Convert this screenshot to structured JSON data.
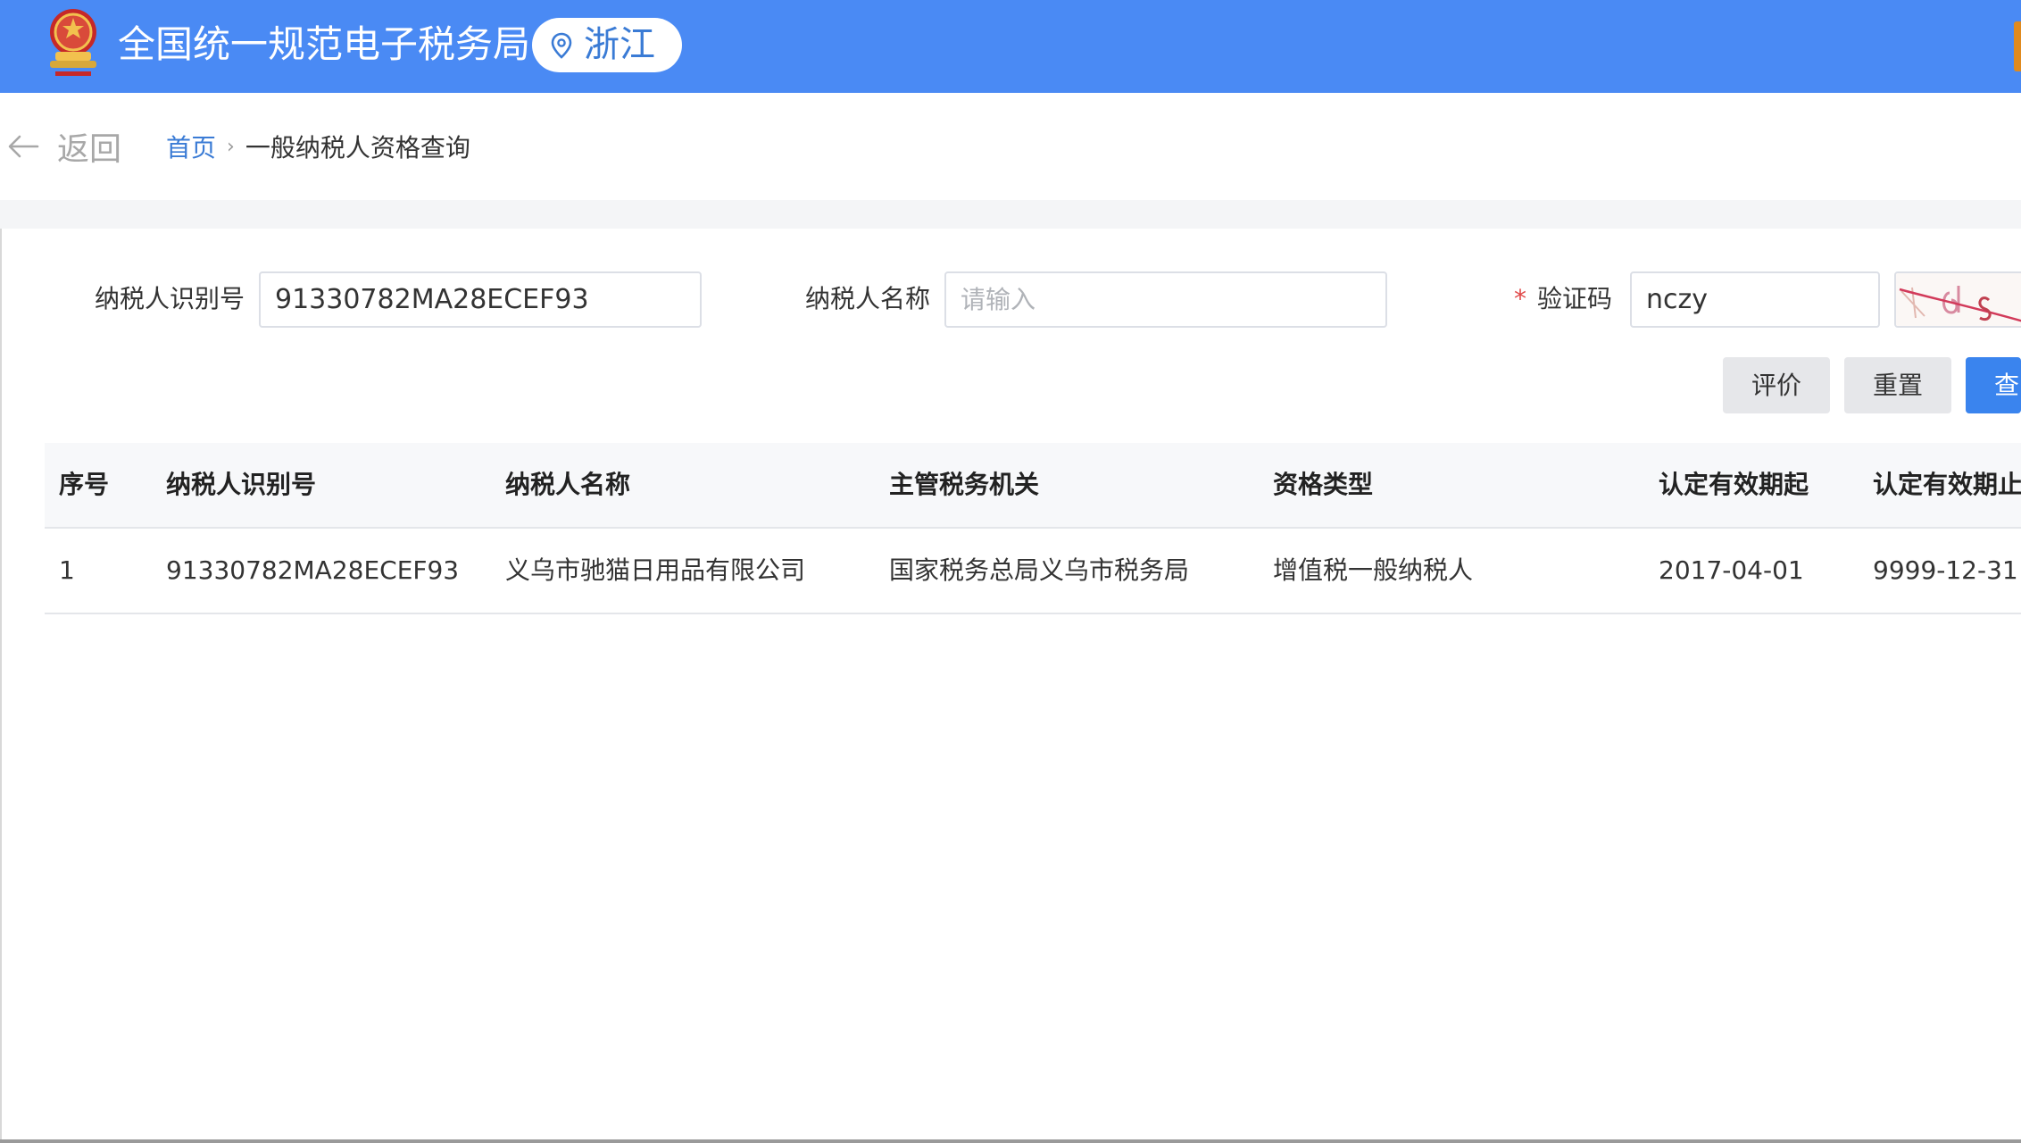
{
  "header": {
    "title": "全国统一规范电子税务局",
    "region": "浙江",
    "colors": {
      "bar": "#4a8af4",
      "accent": "#3a7bd5"
    },
    "icons": [
      "tax-emblem-icon",
      "location-pin-icon"
    ]
  },
  "breadcrumb": {
    "back_label": "返回",
    "home": "首页",
    "current": "一般纳税人资格查询",
    "separator": "›"
  },
  "form": {
    "taxpayer_id_label": "纳税人识别号",
    "taxpayer_id_value": "91330782MA28ECEF93",
    "taxpayer_name_label": "纳税人名称",
    "taxpayer_name_placeholder": "请输入",
    "captcha_required_mark": "*",
    "captcha_label": "验证码",
    "captcha_value": "nczy"
  },
  "actions": {
    "evaluate": "评价",
    "reset": "重置",
    "query": "查"
  },
  "table": {
    "columns": [
      "序号",
      "纳税人识别号",
      "纳税人名称",
      "主管税务机关",
      "资格类型",
      "认定有效期起",
      "认定有效期止"
    ],
    "rows": [
      [
        "1",
        "91330782MA28ECEF93",
        "义乌市驰猫日用品有限公司",
        "国家税务总局义乌市税务局",
        "增值税一般纳税人",
        "2017-04-01",
        "9999-12-31"
      ]
    ]
  }
}
